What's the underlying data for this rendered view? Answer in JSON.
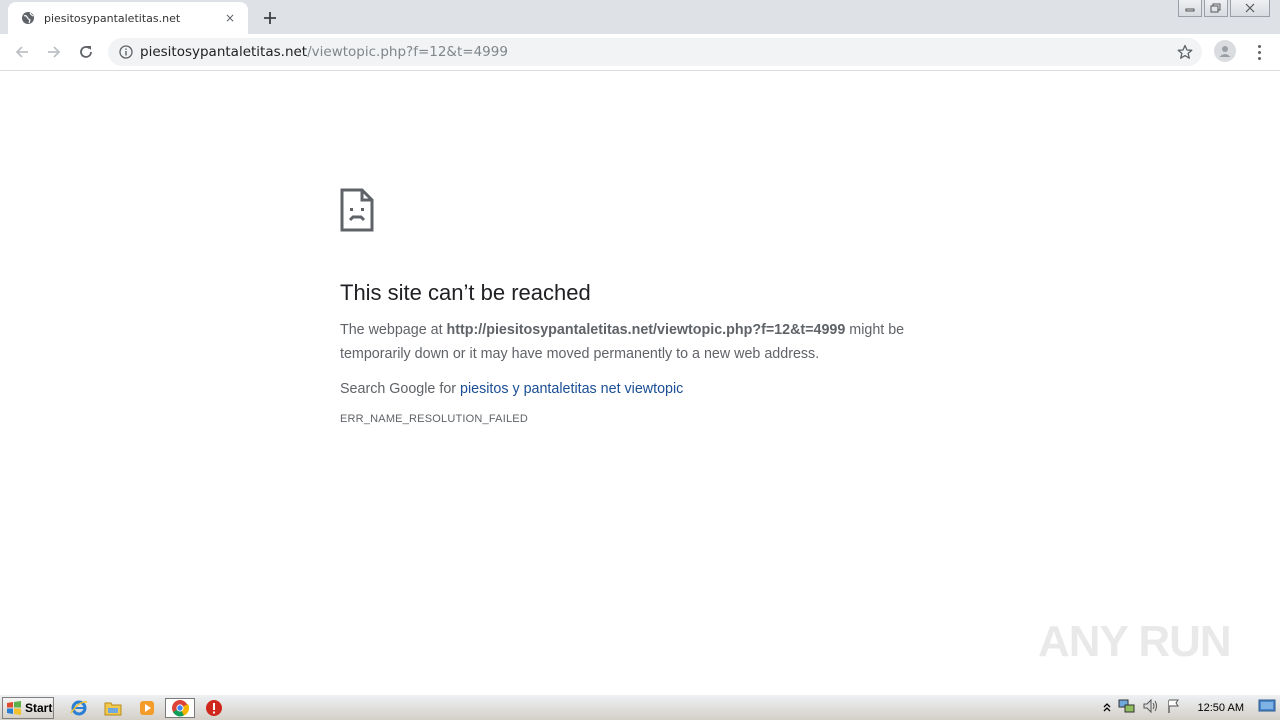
{
  "tab": {
    "title": "piesitosypantaletitas.net",
    "close_icon": "×"
  },
  "window_controls": [
    "minimize-icon",
    "restore-icon",
    "close-icon"
  ],
  "omnibox": {
    "domain": "piesitosypantaletitas.net",
    "path": "/viewtopic.php?f=12&t=4999"
  },
  "error": {
    "title": "This site can’t be reached",
    "desc_prefix": "The webpage at ",
    "desc_url": "http://piesitosypantaletitas.net/viewtopic.php?f=12&t=4999",
    "desc_suffix": " might be temporarily down or it may have moved permanently to a new web address.",
    "search_prefix": "Search Google for ",
    "search_link": "piesitos y pantaletitas net viewtopic",
    "code": "ERR_NAME_RESOLUTION_FAILED"
  },
  "watermark": "ANY RUN",
  "taskbar": {
    "start_label": "Start",
    "apps": [
      "ie-icon",
      "explorer-icon",
      "media-player-icon",
      "chrome-icon",
      "stop-icon"
    ],
    "tray_icons": [
      "show-hidden-icon",
      "network-icon",
      "volume-icon",
      "flag-icon",
      "show-desktop-icon"
    ],
    "clock": "12:50 AM"
  },
  "colors": {
    "tabstrip": "#dee1e6",
    "link": "#1a4e95",
    "text": "#5f6368",
    "title": "#202124"
  }
}
